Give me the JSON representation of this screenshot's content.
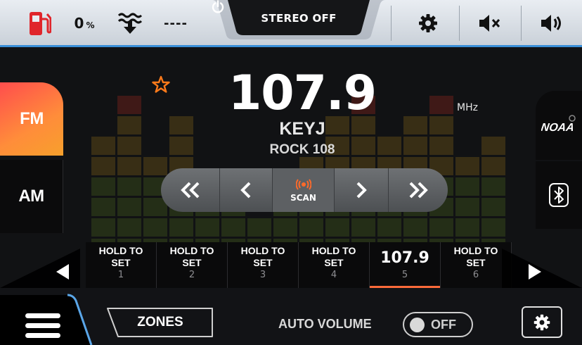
{
  "topbar": {
    "fuel_percent": "0",
    "fuel_unit": "%",
    "depth_value": "----",
    "stereo_label": "STEREO OFF",
    "icons": [
      "fuel-icon",
      "depth-icon",
      "power-icon",
      "gear-icon",
      "mute-icon",
      "volume-icon"
    ],
    "fuel_color": "#e0252b"
  },
  "tuner": {
    "frequency": "107.9",
    "unit": "MHz",
    "station": "KEYJ",
    "genre": "ROCK 108",
    "scan_label": "SCAN",
    "accent_color": "#ff6a3a"
  },
  "bands": [
    {
      "label": "FM",
      "active": true
    },
    {
      "label": "AM",
      "active": false
    }
  ],
  "sources": {
    "noaa_label": "NOAA"
  },
  "presets": [
    {
      "line1": "HOLD TO",
      "line2": "SET",
      "number": "1"
    },
    {
      "line1": "HOLD TO",
      "line2": "SET",
      "number": "2"
    },
    {
      "line1": "HOLD TO",
      "line2": "SET",
      "number": "3"
    },
    {
      "line1": "HOLD TO",
      "line2": "SET",
      "number": "4"
    },
    {
      "frequency": "107.9",
      "number": "5",
      "active": true
    },
    {
      "line1": "HOLD TO",
      "line2": "SET",
      "number": "6"
    }
  ],
  "bottom": {
    "zones_label": "ZONES",
    "auto_volume_label": "AUTO VOLUME",
    "auto_volume_state": "OFF"
  }
}
